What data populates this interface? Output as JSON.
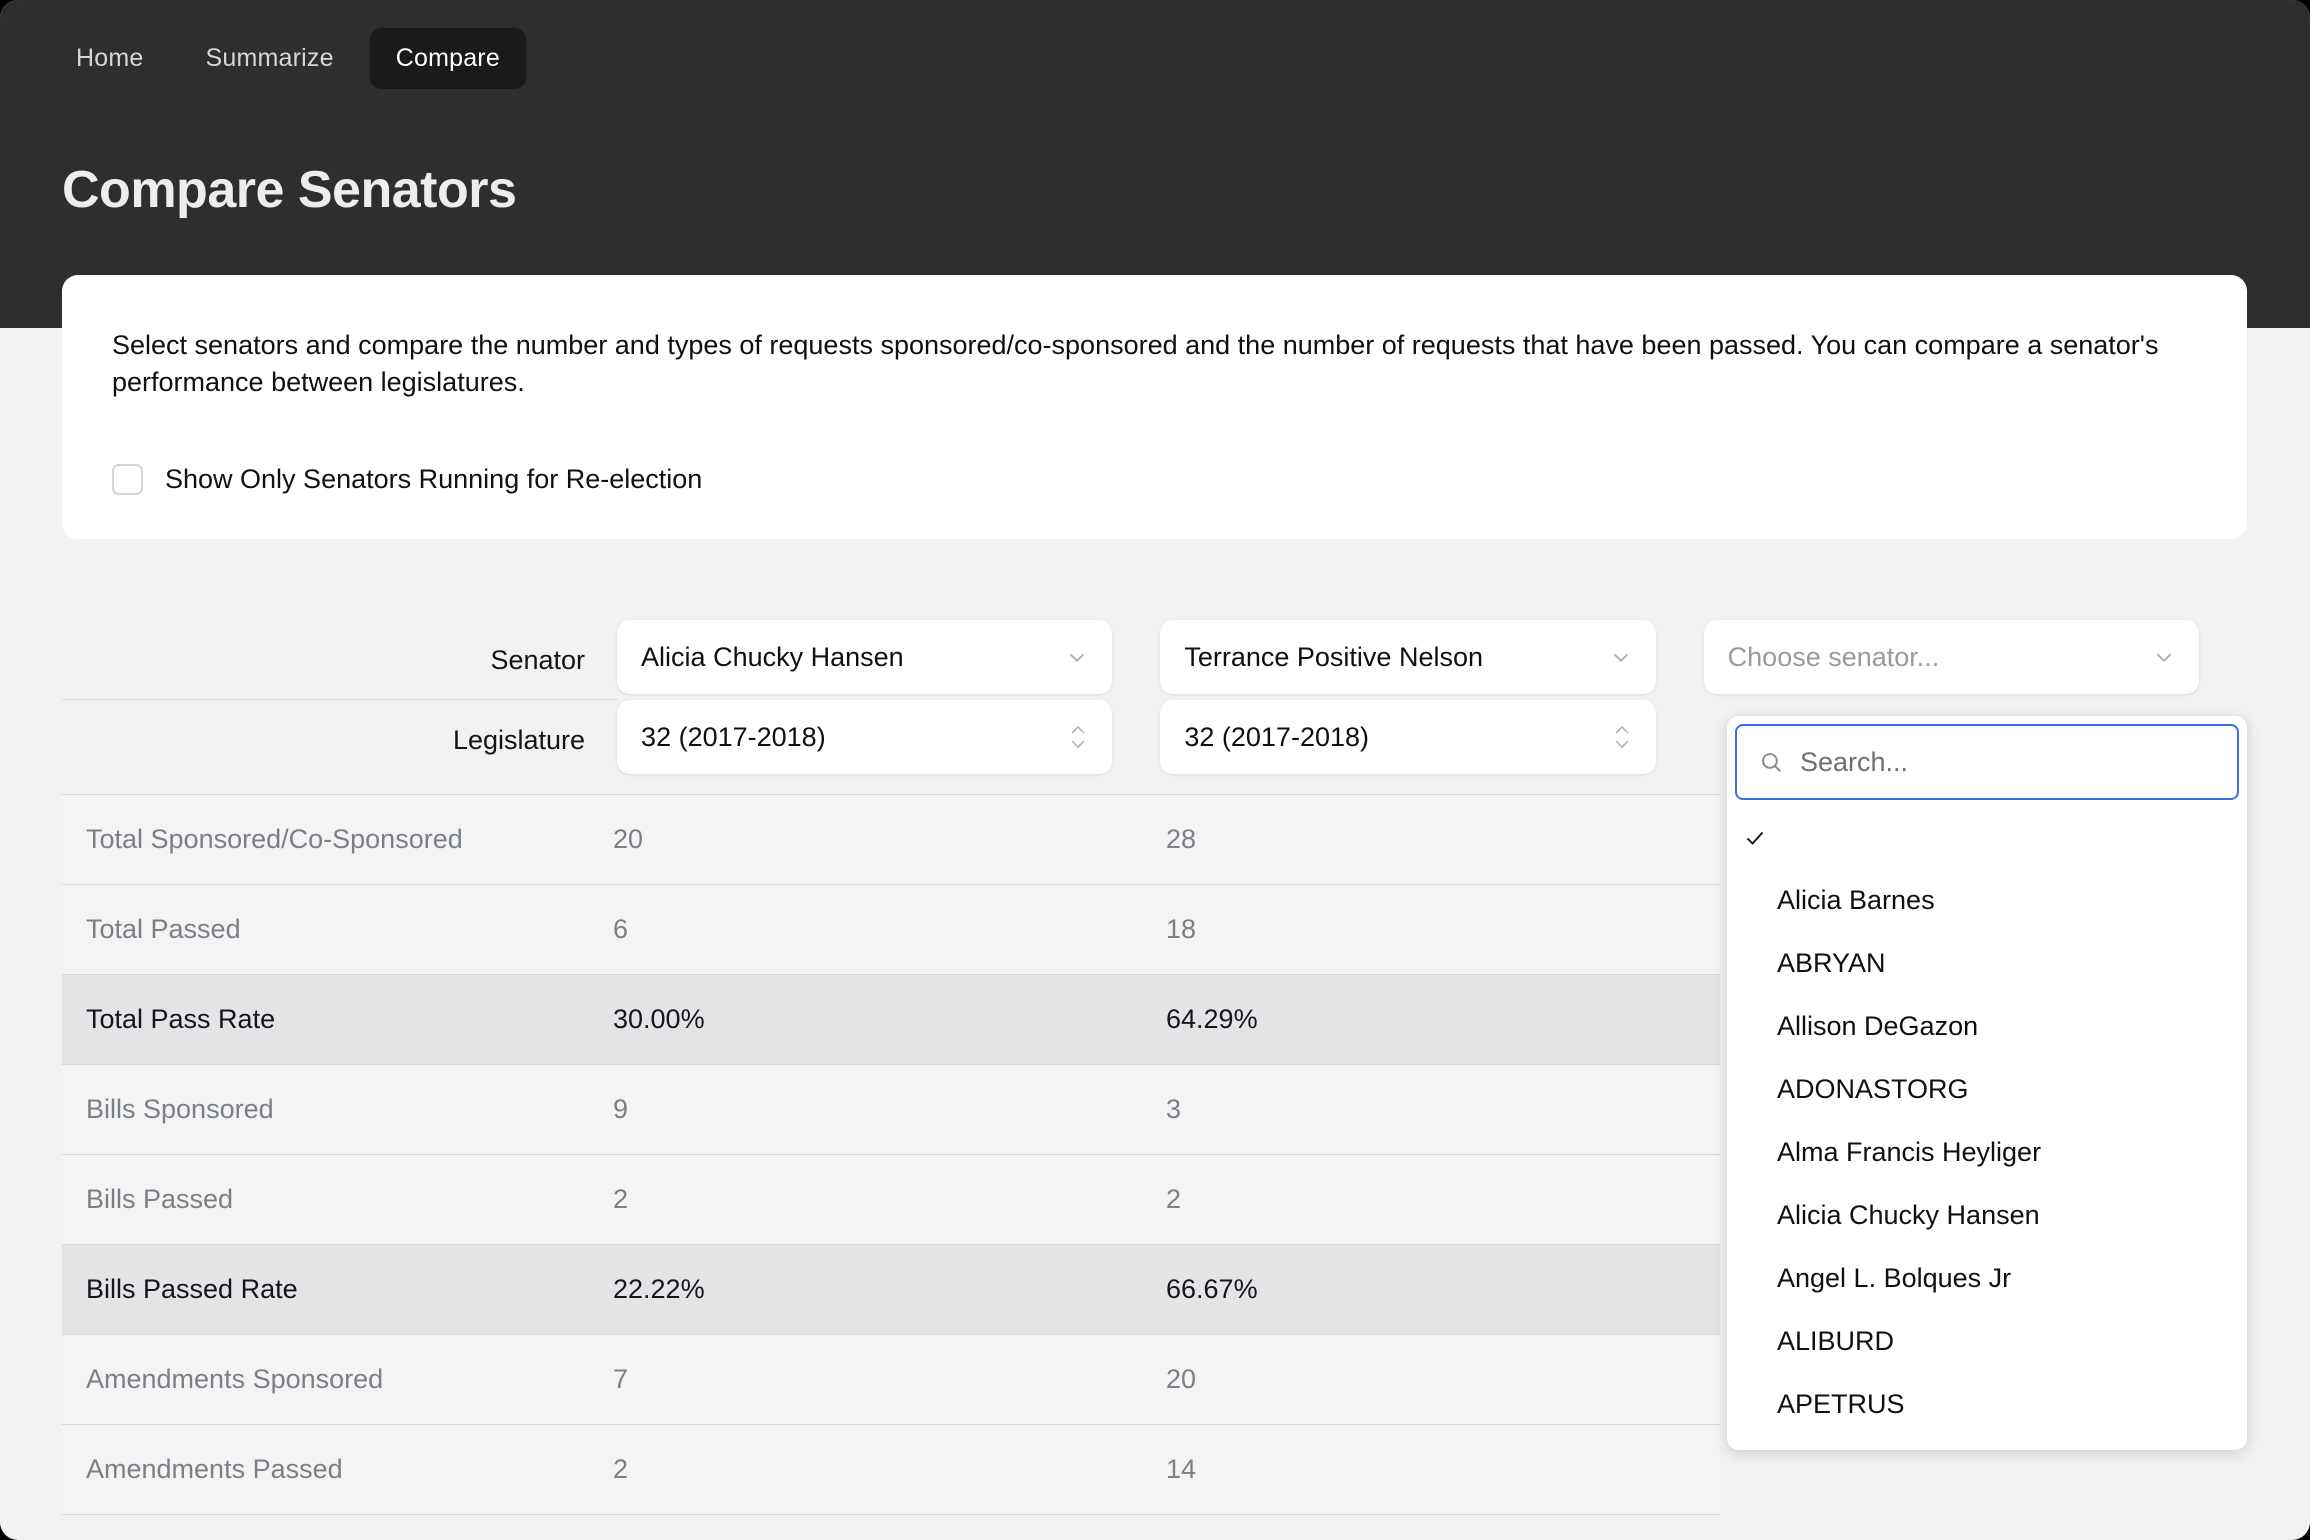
{
  "nav": {
    "items": [
      {
        "label": "Home",
        "active": false
      },
      {
        "label": "Summarize",
        "active": false
      },
      {
        "label": "Compare",
        "active": true
      }
    ]
  },
  "header": {
    "title": "Compare Senators"
  },
  "info_card": {
    "description": "Select senators and compare the number and types of requests sponsored/co-sponsored and the number of requests that have been passed. You can compare a senator's performance between legislatures.",
    "checkbox": {
      "label": "Show Only Senators Running for Re-election",
      "checked": false
    }
  },
  "selectors": {
    "senator_label": "Senator",
    "legislature_label": "Legislature",
    "columns": [
      {
        "senator_value": "Alicia Chucky Hansen",
        "senator_placeholder": "",
        "legislature_value": "32 (2017-2018)"
      },
      {
        "senator_value": "Terrance Positive Nelson",
        "senator_placeholder": "",
        "legislature_value": "32 (2017-2018)"
      },
      {
        "senator_value": "",
        "senator_placeholder": "Choose senator...",
        "legislature_value": ""
      }
    ]
  },
  "dropdown": {
    "search_placeholder": "Search...",
    "selected_index": 0,
    "options": [
      "",
      "Alicia Barnes",
      "ABRYAN",
      "Allison DeGazon",
      "ADONASTORG",
      "Alma Francis Heyliger",
      "Alicia Chucky Hansen",
      "Angel L. Bolques Jr",
      "ALIBURD",
      "APETRUS"
    ]
  },
  "table": {
    "rows": [
      {
        "label": "Total Sponsored/Co-Sponsored",
        "col1": "20",
        "col2": "28",
        "highlight": false
      },
      {
        "label": "Total Passed",
        "col1": "6",
        "col2": "18",
        "highlight": false
      },
      {
        "label": "Total Pass Rate",
        "col1": "30.00%",
        "col2": "64.29%",
        "highlight": true
      },
      {
        "label": "Bills Sponsored",
        "col1": "9",
        "col2": "3",
        "highlight": false
      },
      {
        "label": "Bills Passed",
        "col1": "2",
        "col2": "2",
        "highlight": false
      },
      {
        "label": "Bills Passed Rate",
        "col1": "22.22%",
        "col2": "66.67%",
        "highlight": true
      },
      {
        "label": "Amendments Sponsored",
        "col1": "7",
        "col2": "20",
        "highlight": false
      },
      {
        "label": "Amendments Passed",
        "col1": "2",
        "col2": "14",
        "highlight": false
      }
    ]
  },
  "colors": {
    "header_bg": "#2e2e2e",
    "active_tab_bg": "#1a1a1a",
    "page_bg": "#f2f2f2",
    "card_bg": "#ffffff",
    "focus_blue": "#3b6fe0",
    "row_highlight": "#e3e4e6",
    "muted_text": "#7b7f87"
  }
}
